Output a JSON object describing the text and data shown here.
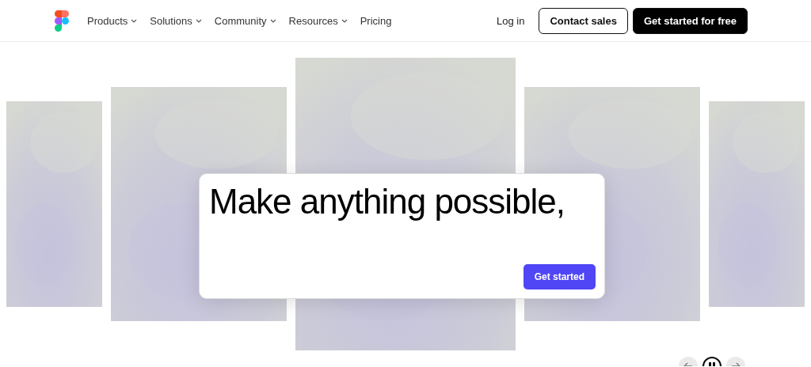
{
  "nav": {
    "items": [
      {
        "label": "Products",
        "dropdown": true
      },
      {
        "label": "Solutions",
        "dropdown": true
      },
      {
        "label": "Community",
        "dropdown": true
      },
      {
        "label": "Resources",
        "dropdown": true
      },
      {
        "label": "Pricing",
        "dropdown": false
      }
    ],
    "login": "Log in",
    "contact": "Contact sales",
    "cta": "Get started for free"
  },
  "hero": {
    "headline": "Make anything possible,",
    "button": "Get started"
  },
  "carousel": {
    "playing": true
  }
}
